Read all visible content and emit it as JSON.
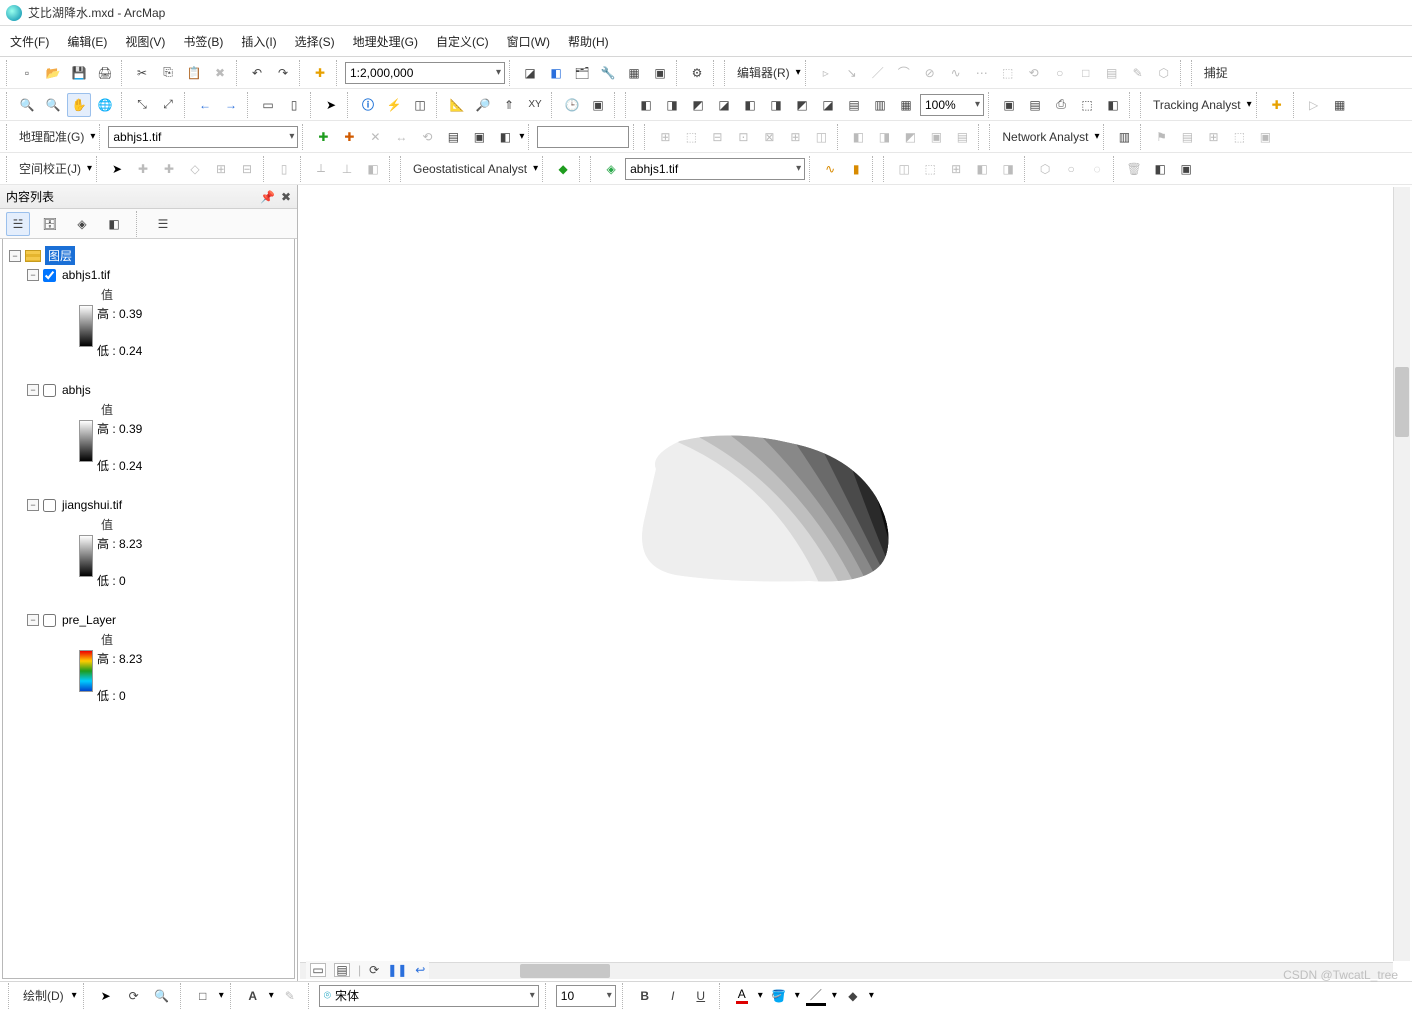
{
  "app": {
    "title": "艾比湖降水.mxd - ArcMap"
  },
  "menu": {
    "file": "文件(F)",
    "edit": "编辑(E)",
    "view": "视图(V)",
    "bookmarks": "书签(B)",
    "insert": "插入(I)",
    "select": "选择(S)",
    "geoproc": "地理处理(G)",
    "custom": "自定义(C)",
    "window": "窗口(W)",
    "help": "帮助(H)"
  },
  "toolbar": {
    "scale": "1:2,000,000",
    "editor": "编辑器(R)",
    "capture": "捕捉",
    "georef_label": "地理配准(G)",
    "georef_layer": "abhjs1.tif",
    "spatial_adjust": "空间校正(J)",
    "geostat": "Geostatistical Analyst",
    "tracking": "Tracking Analyst",
    "network": "Network Analyst",
    "selectable_layer": "abhjs1.tif",
    "zoom_pct": "100%"
  },
  "toc": {
    "panel_title": "内容列表",
    "root": "图层",
    "layers": [
      {
        "name": "abhjs1.tif",
        "checked": true,
        "value_label": "值",
        "high": "高 : 0.39",
        "low": "低 : 0.24",
        "ramp": "gray"
      },
      {
        "name": "abhjs",
        "checked": false,
        "value_label": "值",
        "high": "高 : 0.39",
        "low": "低 : 0.24",
        "ramp": "gray"
      },
      {
        "name": "jiangshui.tif",
        "checked": false,
        "value_label": "值",
        "high": "高 : 8.23",
        "low": "低 : 0",
        "ramp": "gray"
      },
      {
        "name": "pre_Layer",
        "checked": false,
        "value_label": "值",
        "high": "高 : 8.23",
        "low": "低 : 0",
        "ramp": "rainbow"
      }
    ]
  },
  "draw": {
    "label": "绘制(D)",
    "font": "宋体",
    "size": "10",
    "bold": "B",
    "italic": "I",
    "underline": "U",
    "A": "A"
  },
  "watermark": "CSDN @TwcatL_tree"
}
